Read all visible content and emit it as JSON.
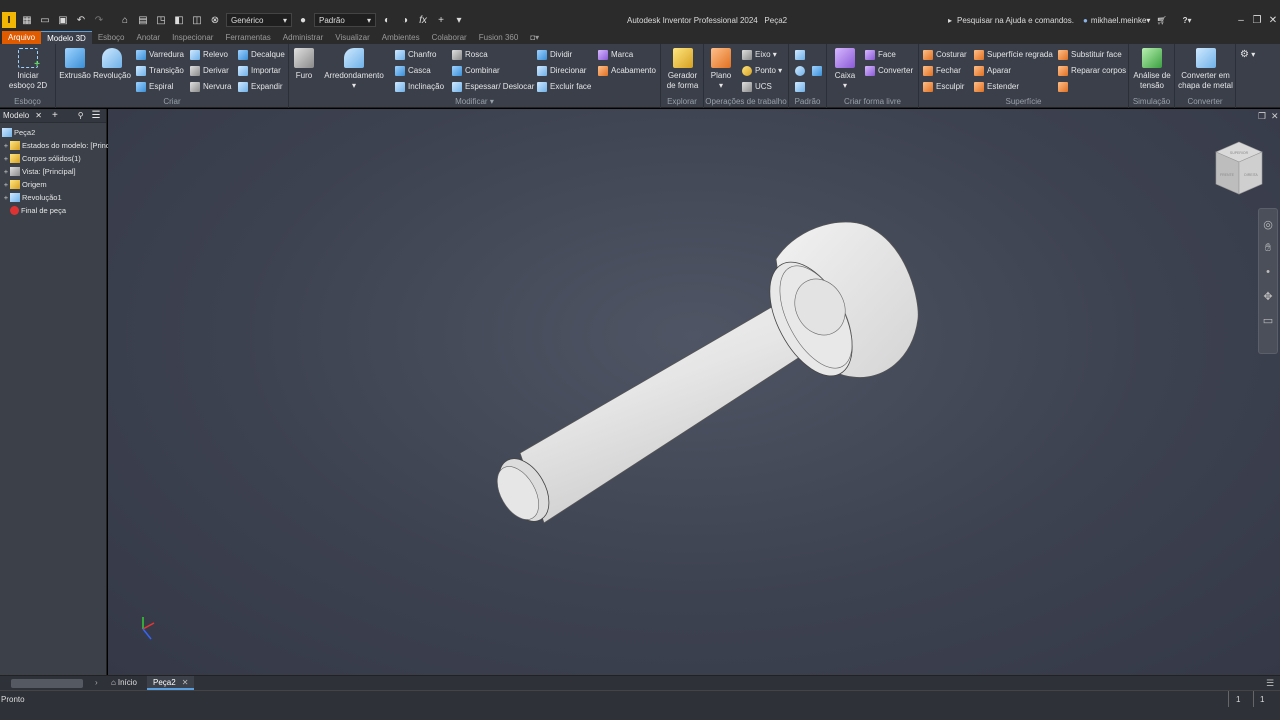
{
  "titlebar": {
    "app_title": "Autodesk Inventor Professional 2024",
    "document_name": "Peça2",
    "material_value": "Genérico",
    "appearance_value": "Padrão",
    "search_text": "Pesquisar na Ajuda e comandos.",
    "user_name": "mikhael.meinke",
    "fx_label": "fx"
  },
  "tabs": {
    "file": "Arquivo",
    "items": [
      "Modelo 3D",
      "Esboço",
      "Anotar",
      "Inspecionar",
      "Ferramentas",
      "Administrar",
      "Visualizar",
      "Ambientes",
      "Colaborar",
      "Fusion 360"
    ]
  },
  "ribbon": {
    "esboco": {
      "title": "Esboço",
      "start_sketch": "Iniciar esboço 2D"
    },
    "criar": {
      "title": "Criar",
      "extrusao": "Extrusão",
      "revolucao": "Revolução",
      "varredura": "Varredura",
      "transicao": "Transição",
      "espiral": "Espiral",
      "relevo": "Relevo",
      "derivar": "Derivar",
      "nervura": "Nervura",
      "decalque": "Decalque",
      "importar": "Importar",
      "expandir": "Expandir"
    },
    "modificar": {
      "title": "Modificar",
      "furo": "Furo",
      "arredondamento": "Arredondamento",
      "chanfro": "Chanfro",
      "casca": "Casca",
      "inclinacao": "Inclinação",
      "rosca": "Rosca",
      "combinar": "Combinar",
      "espessar": "Espessar/ Deslocar",
      "dividir": "Dividir",
      "direcionar": "Direcionar",
      "excluir_face": "Excluir face",
      "marca": "Marca",
      "acabamento": "Acabamento"
    },
    "explorar": {
      "title": "Explorar",
      "gerador": "Gerador de forma"
    },
    "operacoes": {
      "title": "Operações de trabalho",
      "plano": "Plano",
      "eixo": "Eixo",
      "ponto": "Ponto",
      "ucs": "UCS"
    },
    "padrao": {
      "title": "Padrão"
    },
    "forma_livre": {
      "title": "Criar forma livre",
      "caixa": "Caixa",
      "face": "Face",
      "converter": "Converter"
    },
    "superficie": {
      "title": "Superfície",
      "costurar": "Costurar",
      "fechar": "Fechar",
      "esculpir": "Esculpir",
      "superficie_regrada": "Superfície regrada",
      "aparar": "Aparar",
      "estender": "Estender",
      "substituir_face": "Substituir face",
      "reparar_corpos": "Reparar corpos"
    },
    "simulacao": {
      "title": "Simulação",
      "analise": "Análise de tensão"
    },
    "converter": {
      "title": "Converter",
      "chapa": "Converter em chapa de metal"
    }
  },
  "browser": {
    "tab_label": "Modelo",
    "root": "Peça2",
    "items": [
      "Estados do modelo: [Princ",
      "Corpos sólidos(1)",
      "Vista: [Principal]",
      "Origem",
      "Revolução1",
      "Final de peça"
    ]
  },
  "viewcube": {
    "top_label": "SUPERIOR",
    "front_label": "FRENTE",
    "right_label": "DIREITA"
  },
  "doc_tabs": {
    "home": "Início",
    "active": "Peça2"
  },
  "status": {
    "text": "Pronto",
    "count_a": "1",
    "count_b": "1"
  },
  "colors": {
    "file_tab": "#e05a00",
    "ribbon_bg": "#3a3f4a",
    "viewport_center": "#4f5564"
  }
}
